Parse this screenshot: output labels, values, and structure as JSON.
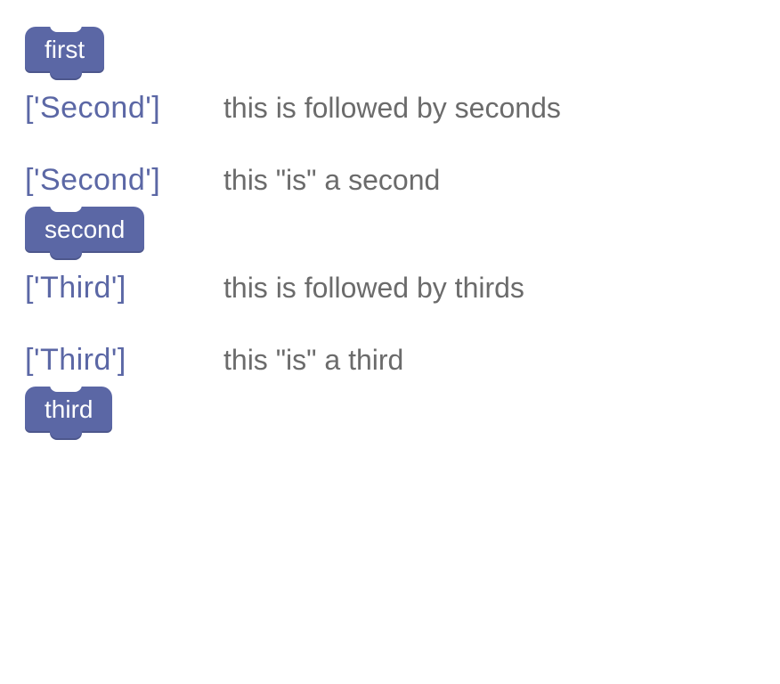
{
  "blocks": {
    "first": {
      "label": "first"
    },
    "second": {
      "label": "second"
    },
    "third": {
      "label": "third"
    }
  },
  "rows": {
    "r1": {
      "tag": "['Second']",
      "desc": "this is followed by seconds"
    },
    "r2": {
      "tag": "['Second']",
      "desc": "this \"is\" a second"
    },
    "r3": {
      "tag": "['Third']",
      "desc": "this is followed by thirds"
    },
    "r4": {
      "tag": "['Third']",
      "desc": "this \"is\" a third"
    }
  }
}
